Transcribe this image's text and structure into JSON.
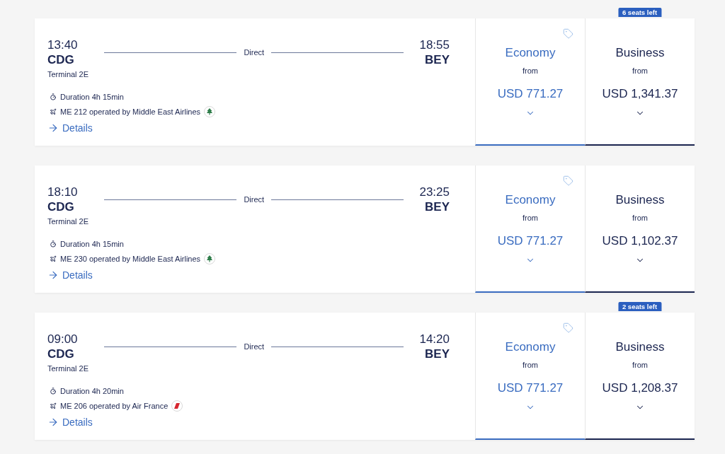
{
  "flights": [
    {
      "departure": {
        "time": "13:40",
        "airport": "CDG",
        "terminal": "Terminal 2E"
      },
      "stop_label": "Direct",
      "arrival": {
        "time": "18:55",
        "airport": "BEY"
      },
      "duration": "Duration 4h 15min",
      "flight_info": "ME 212 operated by Middle East Airlines",
      "logo": {
        "kind": "tree"
      },
      "details_link": "Details",
      "cabins": [
        {
          "kind": "economy",
          "name": "Economy",
          "from": "from",
          "price": "USD 771.27"
        },
        {
          "kind": "business",
          "name": "Business",
          "from": "from",
          "price": "USD 1,341.37",
          "seats_left": "6 seats left"
        }
      ]
    },
    {
      "departure": {
        "time": "18:10",
        "airport": "CDG",
        "terminal": "Terminal 2E"
      },
      "stop_label": "Direct",
      "arrival": {
        "time": "23:25",
        "airport": "BEY"
      },
      "duration": "Duration 4h 15min",
      "flight_info": "ME 230 operated by Middle East Airlines",
      "logo": {
        "kind": "tree"
      },
      "details_link": "Details",
      "cabins": [
        {
          "kind": "economy",
          "name": "Economy",
          "from": "from",
          "price": "USD 771.27"
        },
        {
          "kind": "business",
          "name": "Business",
          "from": "from",
          "price": "USD 1,102.37"
        }
      ]
    },
    {
      "departure": {
        "time": "09:00",
        "airport": "CDG",
        "terminal": "Terminal 2E"
      },
      "stop_label": "Direct",
      "arrival": {
        "time": "14:20",
        "airport": "BEY"
      },
      "duration": "Duration 4h 20min",
      "flight_info": "ME 206 operated by Air France",
      "logo": {
        "kind": "stripe"
      },
      "details_link": "Details",
      "cabins": [
        {
          "kind": "economy",
          "name": "Economy",
          "from": "from",
          "price": "USD 771.27"
        },
        {
          "kind": "business",
          "name": "Business",
          "from": "from",
          "price": "USD 1,208.37",
          "seats_left": "2 seats left"
        }
      ]
    }
  ]
}
